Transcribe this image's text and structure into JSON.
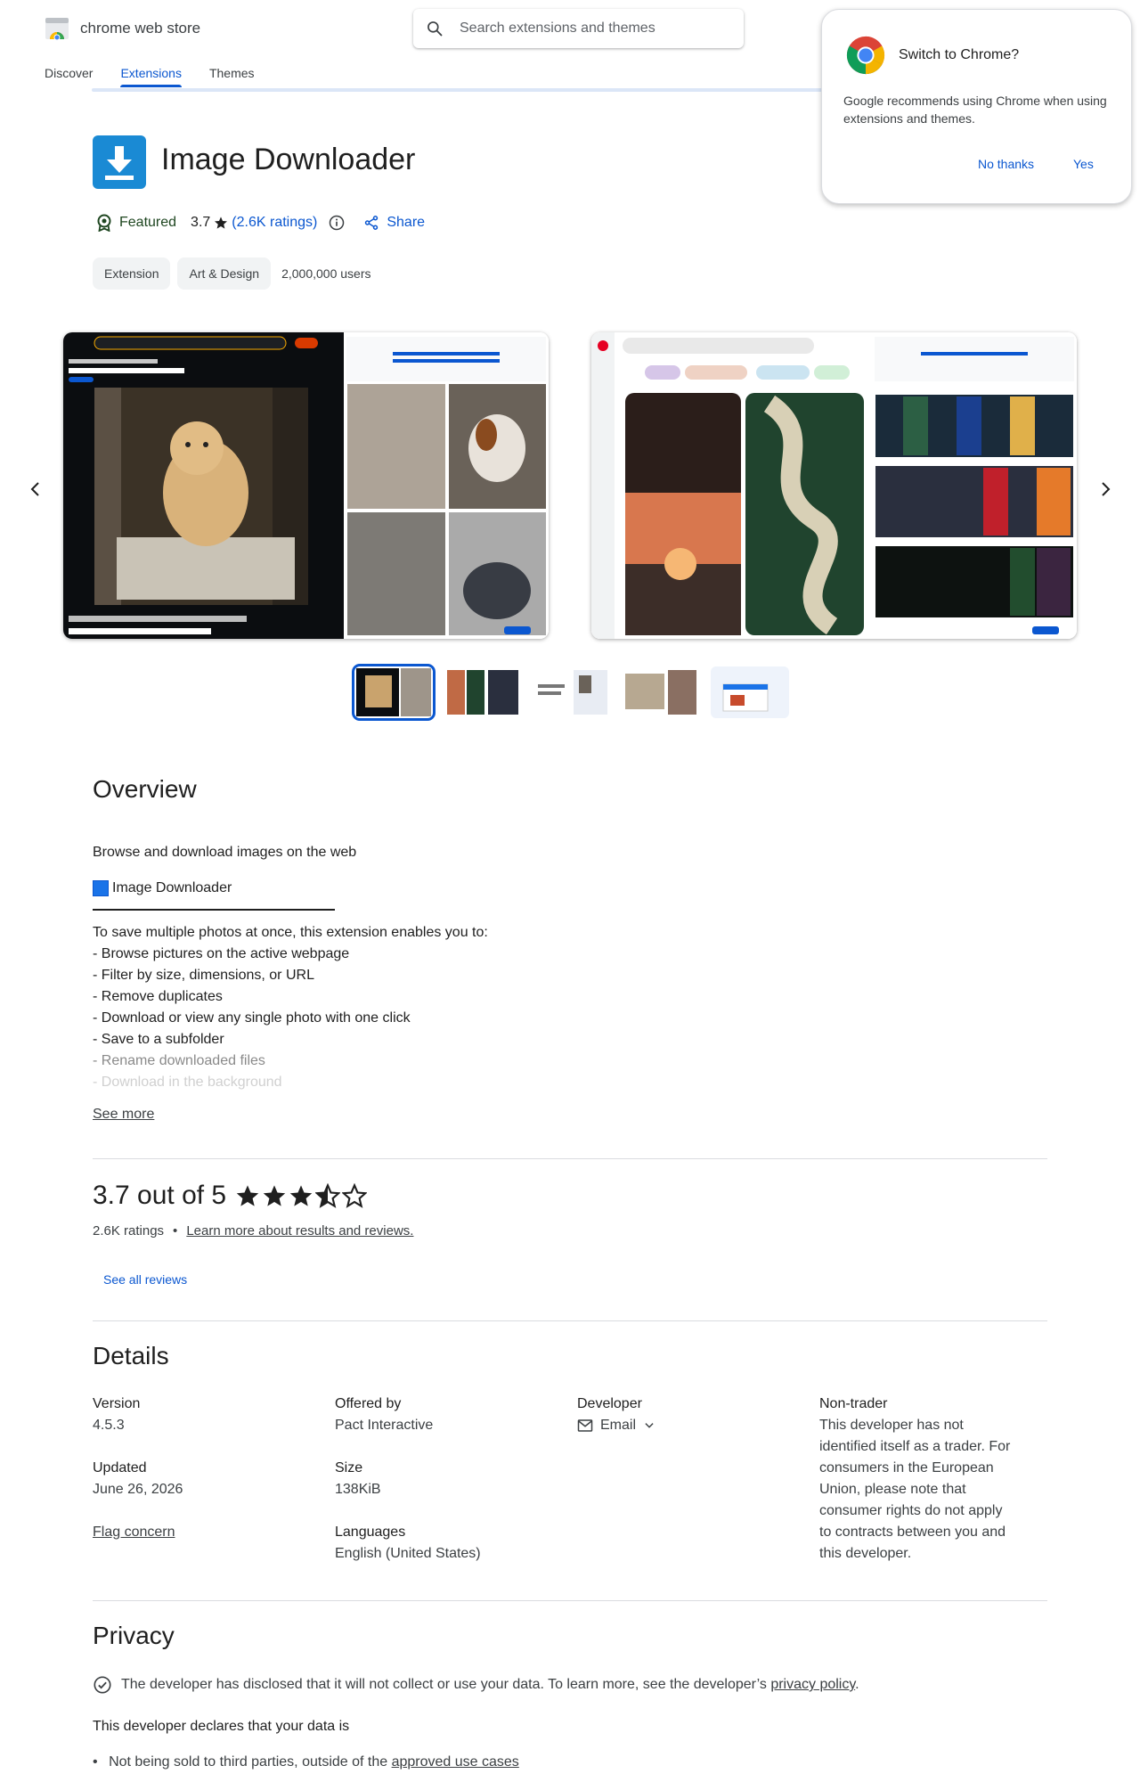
{
  "header": {
    "logo_text": "chrome web store",
    "search_placeholder": "Search extensions and themes",
    "tabs": [
      {
        "label": "Discover",
        "active": false
      },
      {
        "label": "Extensions",
        "active": true
      },
      {
        "label": "Themes",
        "active": false
      }
    ]
  },
  "popup": {
    "title": "Switch to Chrome?",
    "body": "Google recommends using Chrome when using extensions and themes.",
    "no_label": "No thanks",
    "yes_label": "Yes"
  },
  "extension": {
    "title": "Image Downloader",
    "featured_label": "Featured",
    "rating": "3.7",
    "ratings_link": "(2.6K ratings)",
    "share_label": "Share",
    "chips": [
      "Extension",
      "Art & Design"
    ],
    "users": "2,000,000 users"
  },
  "carousel": {
    "thumbnail_count": 5,
    "active_thumbnail": 0
  },
  "overview": {
    "heading": "Overview",
    "description": "Browse and download images on the web",
    "subtitle": "Image Downloader",
    "intro": "To save multiple photos at once, this extension enables you to:",
    "items": [
      "- Browse pictures on the active webpage",
      "- Filter by size, dimensions, or URL",
      "- Remove duplicates",
      "- Download or view any single photo with one click",
      "- Save to a subfolder",
      "- Rename downloaded files",
      "- Download in the background"
    ],
    "see_more": "See more"
  },
  "rating_section": {
    "summary": "3.7 out of 5",
    "stars": 3.7,
    "count": "2.6K ratings",
    "separator": "•",
    "learn_more": "Learn more about results and reviews.",
    "see_all": "See all reviews"
  },
  "details": {
    "heading": "Details",
    "version_label": "Version",
    "version": "4.5.3",
    "updated_label": "Updated",
    "updated": "June 26, 2026",
    "flag": "Flag concern",
    "offered_label": "Offered by",
    "offered": "Pact Interactive",
    "size_label": "Size",
    "size": "138KiB",
    "languages_label": "Languages",
    "languages": "English (United States)",
    "developer_label": "Developer",
    "email_label": "Email",
    "nontrader_label": "Non-trader",
    "nontrader_lines": [
      "This developer has not",
      "identified itself as a trader. For",
      "consumers in the European",
      "Union, please note that",
      "consumer rights do not apply",
      "to contracts between you and",
      "this developer."
    ]
  },
  "privacy": {
    "heading": "Privacy",
    "disclosure": "The developer has disclosed that it will not collect or use your data. To learn more, see the developer’s",
    "policy_link": "privacy policy",
    "period": ".",
    "declares": "This developer declares that your data is",
    "bullet_text": "Not being sold to third parties, outside of the",
    "bullet_link": "approved use cases"
  },
  "colors": {
    "accent": "#0b57d0",
    "app_icon": "#1a8ad4",
    "featured": "#1e4620"
  }
}
